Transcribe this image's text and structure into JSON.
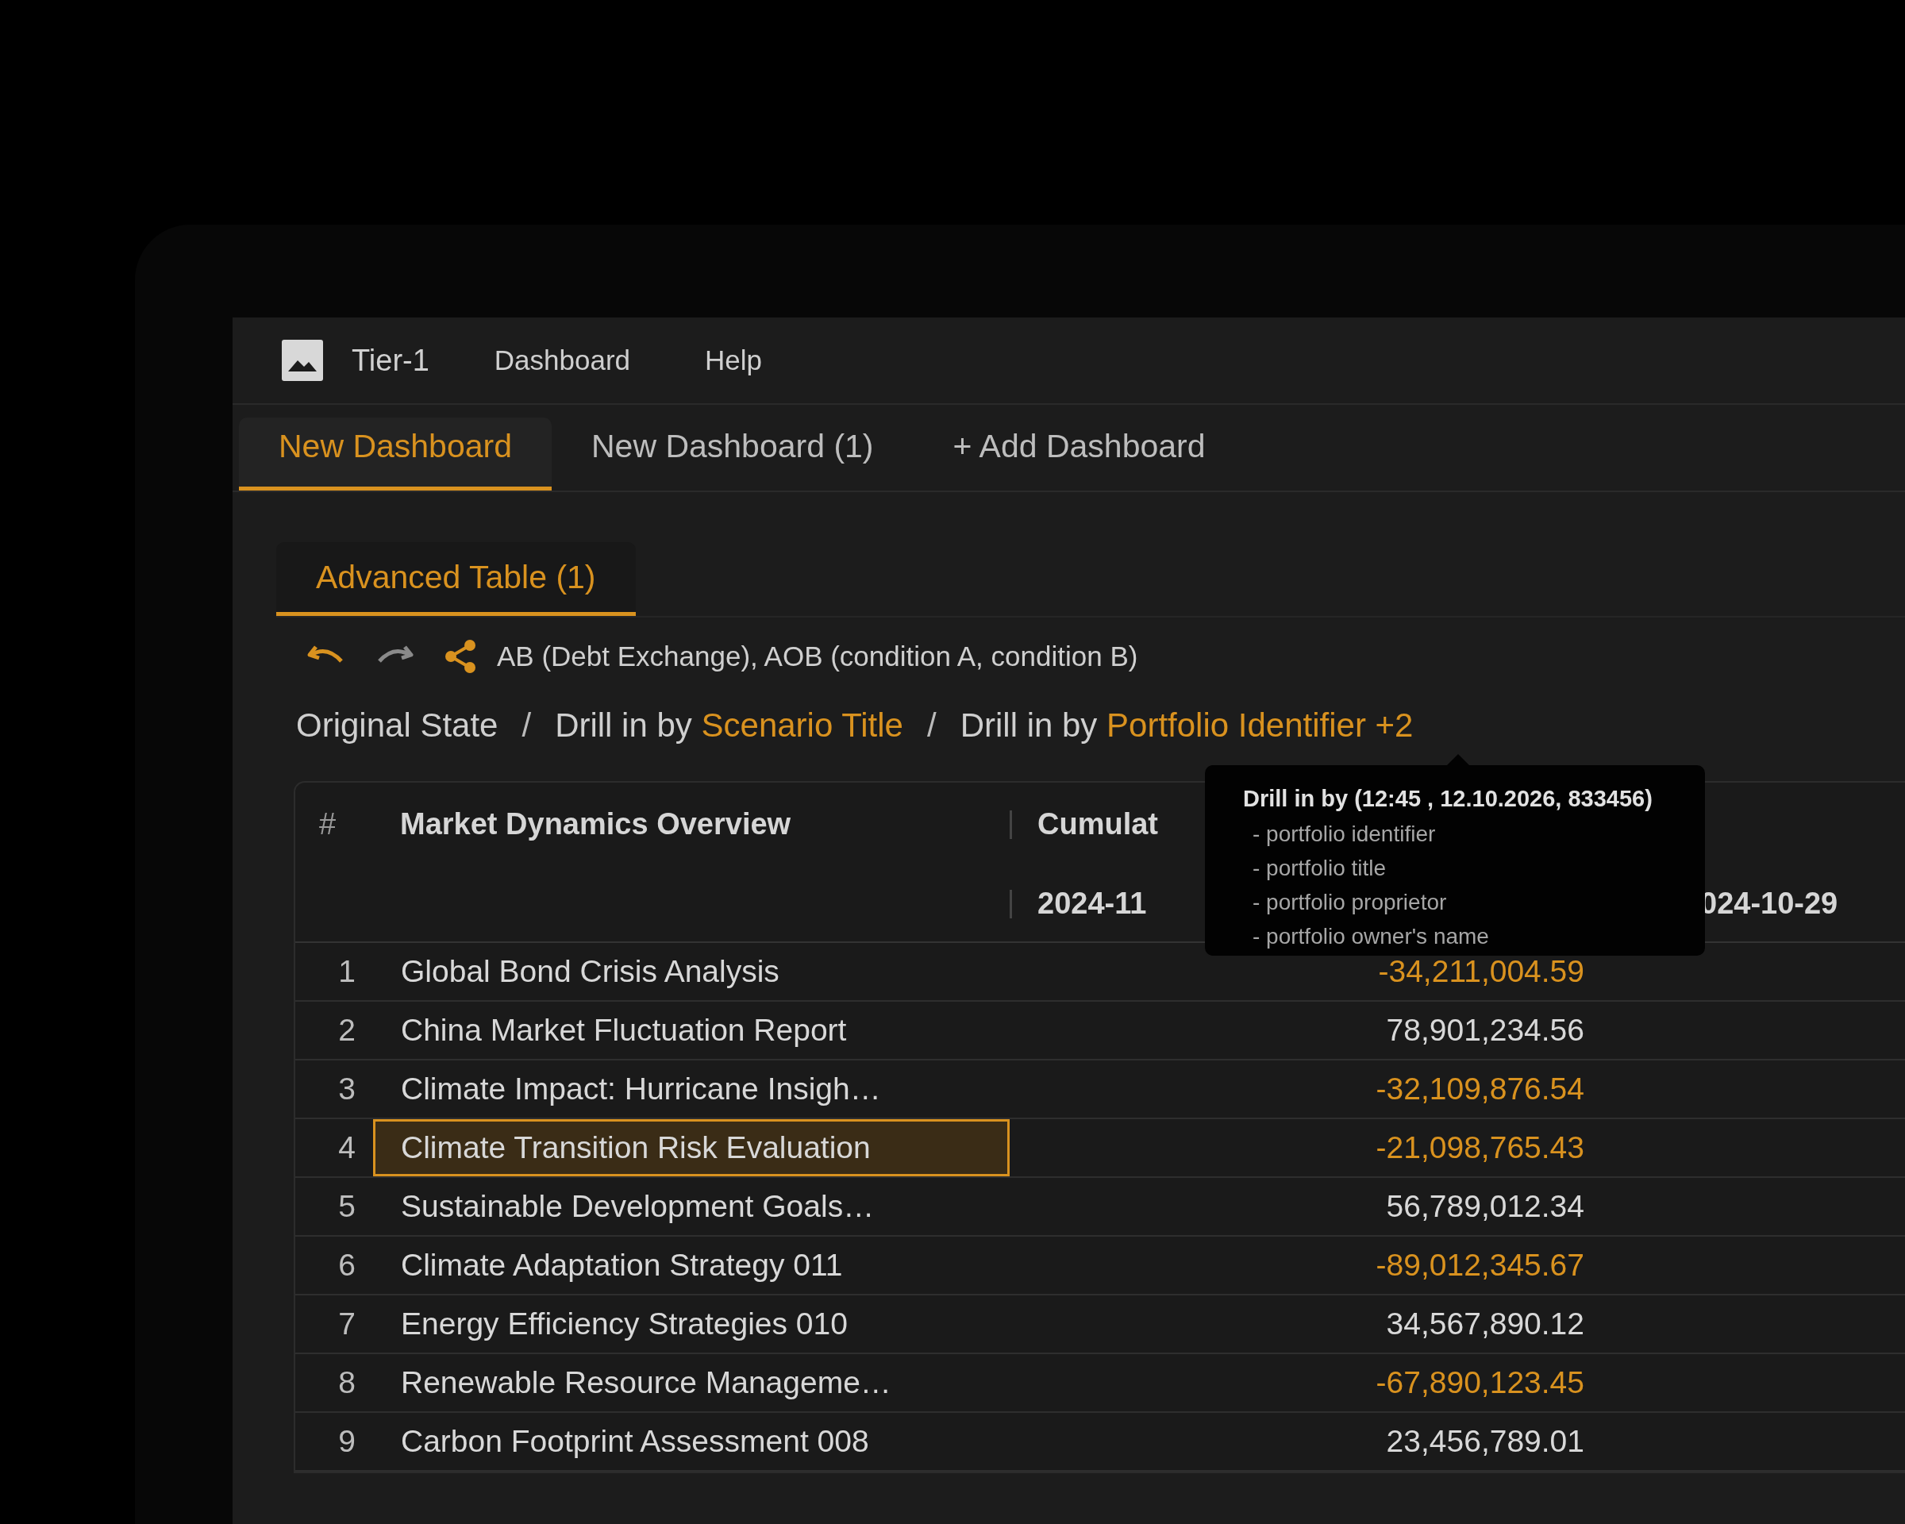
{
  "menu_bar": {
    "app_name": "Tier-1",
    "items": [
      "Dashboard",
      "Help"
    ]
  },
  "tabs": [
    {
      "label": "New Dashboard",
      "selected": true
    },
    {
      "label": "New Dashboard (1)",
      "selected": false
    },
    {
      "label": "+ Add Dashboard",
      "selected": false
    }
  ],
  "widget_tabs": [
    {
      "label": "Advanced Table (1)",
      "selected": true
    }
  ],
  "toolbar": {
    "filter_summary": "AB (Debt Exchange), AOB (condition A, condition B)"
  },
  "breadcrumb": {
    "separator": "/",
    "items": [
      {
        "text": "Original State"
      },
      {
        "text": "Drill in by",
        "highlight": "Scenario Title"
      },
      {
        "text": "Drill in by",
        "highlight": "Portfolio Identifier +2"
      }
    ]
  },
  "table": {
    "header": {
      "index": "#",
      "name": "Market Dynamics Overview",
      "column_3": "Cumulat",
      "column_3_sub": "2024-11",
      "column_4_sub": "024-10-29"
    },
    "rows": [
      {
        "index": "1",
        "name": "Global Bond Crisis Analysis",
        "value": "-34,211,004.59",
        "negative": true,
        "selected": false
      },
      {
        "index": "2",
        "name": "China Market Fluctuation Report",
        "value": "78,901,234.56",
        "negative": false,
        "selected": false
      },
      {
        "index": "3",
        "name": "Climate Impact: Hurricane Insigh…",
        "value": "-32,109,876.54",
        "negative": true,
        "selected": false
      },
      {
        "index": "4",
        "name": "Climate Transition Risk Evaluation",
        "value": "-21,098,765.43",
        "negative": true,
        "selected": true
      },
      {
        "index": "5",
        "name": "Sustainable Development Goals…",
        "value": "56,789,012.34",
        "negative": false,
        "selected": false
      },
      {
        "index": "6",
        "name": "Climate Adaptation Strategy 011",
        "value": "-89,012,345.67",
        "negative": true,
        "selected": false
      },
      {
        "index": "7",
        "name": "Energy Efficiency Strategies 010",
        "value": "34,567,890.12",
        "negative": false,
        "selected": false
      },
      {
        "index": "8",
        "name": "Renewable Resource Manageme…",
        "value": "-67,890,123.45",
        "negative": true,
        "selected": false
      },
      {
        "index": "9",
        "name": "Carbon Footprint Assessment 008",
        "value": "23,456,789.01",
        "negative": false,
        "selected": false
      }
    ]
  },
  "tooltip": {
    "title": "Drill in by (12:45 , 12.10.2026, 833456)",
    "items": [
      "- portfolio identifier",
      "- portfolio title",
      "- portfolio proprietor",
      "- portfolio owner's name"
    ]
  }
}
